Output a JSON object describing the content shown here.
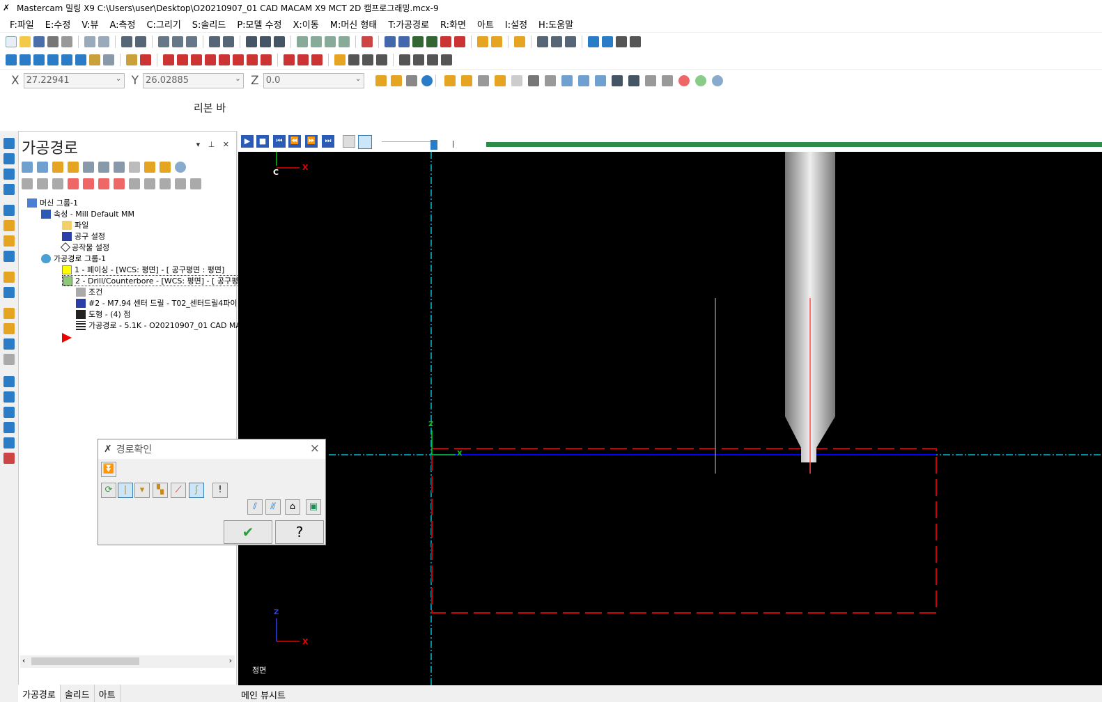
{
  "window": {
    "title": "Mastercam 밀링 X9   C:\\Users\\user\\Desktop\\O20210907_01 CAD MACAM X9 MCT 2D 캠프로그래밍.mcx-9"
  },
  "menu": [
    "F:파일",
    "E:수정",
    "V:뷰",
    "A:측정",
    "C:그리기",
    "S:솔리드",
    "P:모델 수정",
    "X:이동",
    "M:머신 형태",
    "T:가공경로",
    "R:화면",
    "아트",
    "I:설정",
    "H:도움말"
  ],
  "coords": {
    "x_label": "X",
    "x_value": "27.22941",
    "y_label": "Y",
    "y_value": "26.02885",
    "z_label": "Z",
    "z_value": "0.0"
  },
  "ribbon_label": "리본 바",
  "panel": {
    "title": "가공경로",
    "tree": [
      {
        "label": "머신 그룹-1",
        "icon": "machine-group-icon"
      },
      {
        "label": "속성 - Mill Default MM",
        "icon": "properties-icon"
      },
      {
        "label": "파일",
        "icon": "folder-icon"
      },
      {
        "label": "공구 설정",
        "icon": "tool-icon"
      },
      {
        "label": "공작물 설정",
        "icon": "stock-icon"
      },
      {
        "label": "가공경로 그룹-1",
        "icon": "toolpath-group-icon"
      },
      {
        "label": "1 - 페이싱 - [WCS: 평면] - [ 공구평면 : 평면]",
        "icon": "folder-icon"
      },
      {
        "label": "2 - Drill/Counterbore - [WCS: 평면] - [ 공구평",
        "icon": "open-folder-icon"
      },
      {
        "label": "조건",
        "icon": "parameters-icon"
      },
      {
        "label": "#2 - M7.94 센터 드릴 - T02_센터드릴4파이",
        "icon": "tool-icon"
      },
      {
        "label": "도형 - (4) 점",
        "icon": "geometry-icon"
      },
      {
        "label": "가공경로 - 5.1K - O20210907_01 CAD MAC",
        "icon": "toolpath-icon"
      }
    ]
  },
  "bottom_tabs": [
    "가공경로",
    "솔리드",
    "아트"
  ],
  "viewport": {
    "view_name": "정면",
    "sheet_tab": "메인 뷰시트",
    "c_label": "C",
    "x_label": "X",
    "z_label": "Z"
  },
  "dialog": {
    "title": "경로확인",
    "ok_glyph": "✔",
    "help_glyph": "?"
  },
  "colors": {
    "viewport_bg": "#000000",
    "stock": "#cc0000",
    "axis_blue": "#0000ff",
    "axis_cyan": "#00bcd4",
    "progress": "#2e8b4a"
  },
  "playback_progress": 0.05
}
